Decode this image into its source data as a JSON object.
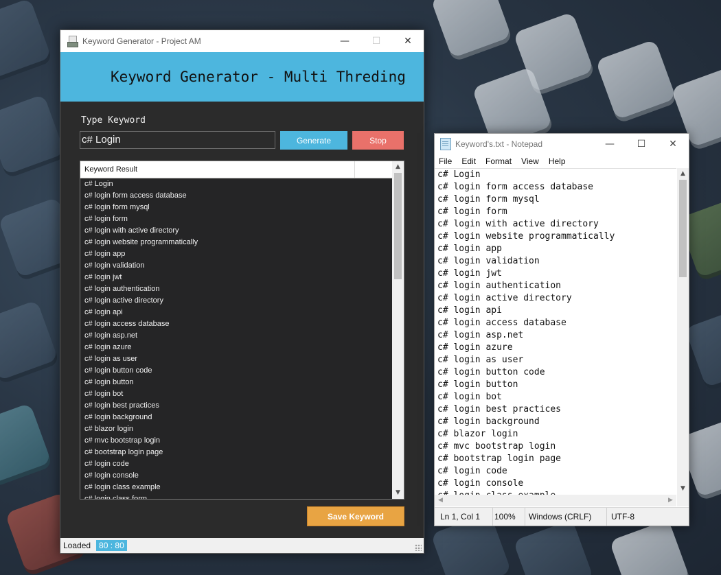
{
  "keyword_generator": {
    "window_title": "Keyword Generator - Project AM",
    "header_title": "Keyword Generator - Multi Threding",
    "type_keyword_label": "Type Keyword",
    "keyword_input_value": "c# Login",
    "generate_label": "Generate",
    "stop_label": "Stop",
    "list_header": "Keyword Result",
    "results": [
      "c# Login",
      "c# login form access database",
      "c# login form mysql",
      "c# login form",
      "c# login with active directory",
      "c# login website programmatically",
      "c# login app",
      "c# login validation",
      "c# login jwt",
      "c# login authentication",
      "c# login active directory",
      "c# login api",
      "c# login access database",
      "c# login asp.net",
      "c# login azure",
      "c# login as user",
      "c# login button code",
      "c# login button",
      "c# login bot",
      "c# login best practices",
      "c# login background",
      "c# blazor login",
      "c# mvc bootstrap login",
      "c# bootstrap login page",
      "c# login code",
      "c# login console",
      "c# login class example",
      "c# login class form"
    ],
    "save_label": "Save Keyword",
    "status_text": "Loaded",
    "status_count": "80 : 80",
    "colors": {
      "accent": "#4db6de",
      "stop": "#e9716a",
      "save": "#e8a443"
    }
  },
  "notepad": {
    "window_title": "Keyword's.txt - Notepad",
    "menu": [
      "File",
      "Edit",
      "Format",
      "View",
      "Help"
    ],
    "lines": [
      "c# Login",
      "c# login form access database",
      "c# login form mysql",
      "c# login form",
      "c# login with active directory",
      "c# login website programmatically",
      "c# login app",
      "c# login validation",
      "c# login jwt",
      "c# login authentication",
      "c# login active directory",
      "c# login api",
      "c# login access database",
      "c# login asp.net",
      "c# login azure",
      "c# login as user",
      "c# login button code",
      "c# login button",
      "c# login bot",
      "c# login best practices",
      "c# login background",
      "c# blazor login",
      "c# mvc bootstrap login",
      "c# bootstrap login page",
      "c# login code",
      "c# login console",
      "c# login class example"
    ],
    "status": {
      "position": "Ln 1, Col 1",
      "zoom": "100%",
      "line_ending": "Windows (CRLF)",
      "encoding": "UTF-8"
    }
  }
}
